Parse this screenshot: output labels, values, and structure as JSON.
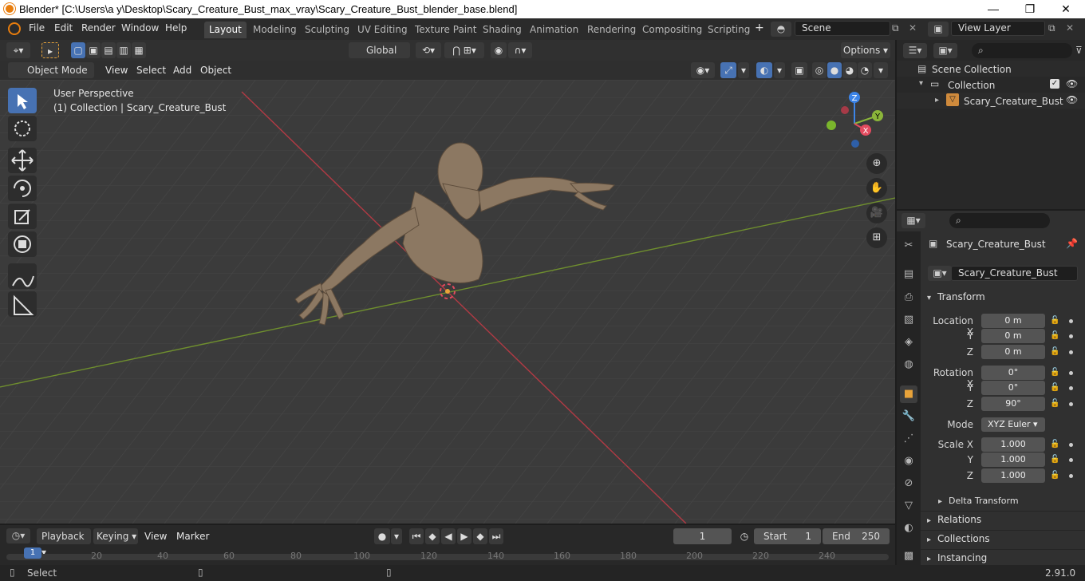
{
  "window": {
    "title": "Blender* [C:\\Users\\a y\\Desktop\\Scary_Creature_Bust_max_vray\\Scary_Creature_Bust_blender_base.blend]",
    "minimize": "—",
    "maximize": "❐",
    "close": "✕"
  },
  "menu": [
    "File",
    "Edit",
    "Render",
    "Window",
    "Help"
  ],
  "workspaces": [
    "Layout",
    "Modeling",
    "Sculpting",
    "UV Editing",
    "Texture Paint",
    "Shading",
    "Animation",
    "Rendering",
    "Compositing",
    "Scripting"
  ],
  "active_workspace": "Layout",
  "add_workspace": "+",
  "scene": {
    "label": "Scene"
  },
  "view_layer": {
    "label": "View Layer"
  },
  "viewport_header": {
    "transform_orientation": "Global",
    "options": "Options",
    "mode": "Object Mode",
    "menus": [
      "View",
      "Select",
      "Add",
      "Object"
    ]
  },
  "viewport": {
    "perspective": "User Perspective",
    "collection_info": "(1) Collection | Scary_Creature_Bust",
    "gizmo": {
      "x": "X",
      "y": "Y",
      "z": "Z"
    }
  },
  "outliner": {
    "scene_collection": "Scene Collection",
    "collection": "Collection",
    "object": "Scary_Creature_Bust"
  },
  "properties": {
    "object_name": "Scary_Creature_Bust",
    "data_name": "Scary_Creature_Bust",
    "transform": "Transform",
    "location": {
      "label_x": "Location X",
      "label_y": "Y",
      "label_z": "Z",
      "x": "0 m",
      "y": "0 m",
      "z": "0 m"
    },
    "rotation": {
      "label_x": "Rotation X",
      "label_y": "Y",
      "label_z": "Z",
      "x": "0°",
      "y": "0°",
      "z": "90°"
    },
    "mode": {
      "label": "Mode",
      "value": "XYZ Euler"
    },
    "scale": {
      "label_x": "Scale X",
      "label_y": "Y",
      "label_z": "Z",
      "x": "1.000",
      "y": "1.000",
      "z": "1.000"
    },
    "delta_transform": "Delta Transform",
    "relations": "Relations",
    "collections": "Collections",
    "instancing": "Instancing"
  },
  "timeline": {
    "menus": [
      "Playback",
      "Keying",
      "View",
      "Marker"
    ],
    "current_frame": "1",
    "start_label": "Start",
    "start": "1",
    "end_label": "End",
    "end": "250",
    "ticks": [
      "1",
      "20",
      "40",
      "60",
      "80",
      "100",
      "120",
      "140",
      "160",
      "180",
      "200",
      "220",
      "240"
    ]
  },
  "status": {
    "select": "Select",
    "version": "2.91.0"
  },
  "colors": {
    "accent": "#4772b3",
    "x_axis": "#e34b5f",
    "y_axis": "#8bb53a",
    "z_axis": "#3c84e8",
    "creature": "#8c7862"
  }
}
